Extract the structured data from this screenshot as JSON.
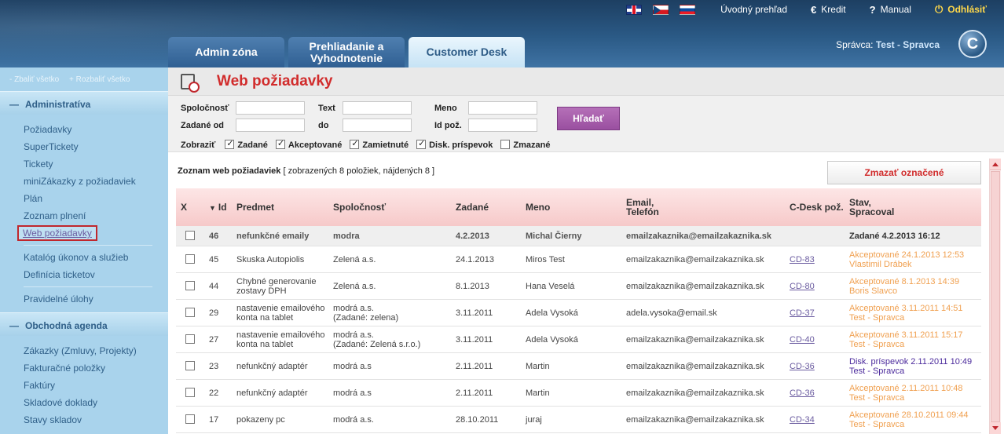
{
  "header": {
    "languages": [
      "uk-flag-icon",
      "cz-flag-icon",
      "sk-flag-icon"
    ],
    "links": {
      "overview": "Úvodný prehľad",
      "credit": "Kredit",
      "manual": "Manual",
      "logout": "Odhlásiť"
    },
    "tabs": [
      {
        "label": "Admin zóna"
      },
      {
        "label": "Prehliadanie a Vyhodnotenie"
      },
      {
        "label": "Customer Desk"
      }
    ],
    "admin_label": "Správca:",
    "admin_name": "Test - Spravca",
    "logo": "C"
  },
  "sidebar": {
    "collapse_all": "- Zbaliť všetko",
    "expand_all": "+ Rozbaliť všetko",
    "sections": [
      {
        "title": "Administratíva",
        "items": [
          "Požiadavky",
          "SuperTickety",
          "Tickety",
          "miniZákazky z požiadaviek",
          "Plán",
          "Zoznam plnení",
          "Web požiadavky",
          "Katalóg úkonov a služieb",
          "Definícia ticketov",
          "Pravidelné úlohy"
        ]
      },
      {
        "title": "Obchodná agenda",
        "items": [
          "Zákazky (Zmluvy, Projekty)",
          "Fakturačné položky",
          "Faktúry",
          "Skladové doklady",
          "Stavy skladov"
        ]
      }
    ]
  },
  "main": {
    "title": "Web požiadavky",
    "filter": {
      "company": "Spoločnosť",
      "text": "Text",
      "name": "Meno",
      "entered_from": "Zadané od",
      "to": "do",
      "req_id": "Id pož.",
      "search_button": "Hľadať",
      "show_label": "Zobraziť",
      "options": [
        "Zadané",
        "Akceptované",
        "Zamietnuté",
        "Disk. príspevok",
        "Zmazané"
      ]
    },
    "list_title": "Zoznam web požiadaviek",
    "list_count": "[ zobrazených 8 položiek, nájdených 8 ]",
    "delete_button": "Zmazať označené",
    "columns": {
      "x": "X",
      "id": "Id",
      "subject": "Predmet",
      "company": "Spoločnosť",
      "entered": "Zadané",
      "name": "Meno",
      "email1": "Email,",
      "email2": "Telefón",
      "cdesk": "C-Desk pož.",
      "status1": "Stav,",
      "status2": "Spracoval"
    },
    "rows": [
      {
        "id": "46",
        "subject": "nefunkčné emaily",
        "company": "modra",
        "company2": "",
        "entered": "4.2.2013",
        "name": "Michal Čierny",
        "email": "emailzakaznika@emailzakaznika.sk",
        "cdesk": "",
        "status": "Zadané 4.2.2013 16:12",
        "by": ""
      },
      {
        "id": "45",
        "subject": "Skuska Autopiolis",
        "company": "Zelená a.s.",
        "company2": "",
        "entered": "24.1.2013",
        "name": "Miros Test",
        "email": "emailzakaznika@emailzakaznika.sk",
        "cdesk": "CD-83",
        "status": "Akceptované 24.1.2013 12:53",
        "by": "Vlastimil Drábek"
      },
      {
        "id": "44",
        "subject": "Chybné generovanie zostavy DPH",
        "company": "Zelená a.s.",
        "company2": "",
        "entered": "8.1.2013",
        "name": "Hana Veselá",
        "email": "emailzakaznika@emailzakaznika.sk",
        "cdesk": "CD-80",
        "status": "Akceptované 8.1.2013 14:39",
        "by": "Boris Slavco"
      },
      {
        "id": "29",
        "subject": "nastavenie emailového konta na tablet",
        "company": "modrá a.s.",
        "company2": "(Zadané: zelena)",
        "entered": "3.11.2011",
        "name": "Adela Vysoká",
        "email": "adela.vysoka@email.sk",
        "cdesk": "CD-37",
        "status": "Akceptované 3.11.2011 14:51",
        "by": "Test - Spravca"
      },
      {
        "id": "27",
        "subject": "nastavenie emailového konta na tablet",
        "company": "modrá a.s.",
        "company2": "(Zadané: Zelená s.r.o.)",
        "entered": "3.11.2011",
        "name": "Adela Vysoká",
        "email": "emailzakaznika@emailzakaznika.sk",
        "cdesk": "CD-40",
        "status": "Akceptované 3.11.2011 15:17",
        "by": "Test - Spravca"
      },
      {
        "id": "23",
        "subject": "nefunkčný adaptér",
        "company": "modrá a.s",
        "company2": "",
        "entered": "2.11.2011",
        "name": "Martin",
        "email": "emailzakaznika@emailzakaznika.sk",
        "cdesk": "CD-36",
        "status": "Disk. príspevok 2.11.2011 10:49",
        "by": "Test - Spravca"
      },
      {
        "id": "22",
        "subject": "nefunkčný adaptér",
        "company": "modrá a.s",
        "company2": "",
        "entered": "2.11.2011",
        "name": "Martin",
        "email": "emailzakaznika@emailzakaznika.sk",
        "cdesk": "CD-36",
        "status": "Akceptované 2.11.2011 10:48",
        "by": "Test - Spravca"
      },
      {
        "id": "17",
        "subject": "pokazeny pc",
        "company": "modrá a.s.",
        "company2": "",
        "entered": "28.10.2011",
        "name": "juraj",
        "email": "emailzakaznika@emailzakaznika.sk",
        "cdesk": "CD-34",
        "status": "Akceptované 28.10.2011 09:44",
        "by": "Test - Spravca"
      }
    ]
  },
  "colors": {
    "header_blue": "#2b5a86",
    "sidebar_blue": "#a9d3ec",
    "accent_red": "#d12c2c",
    "button_purple": "#9a4fa0",
    "status_accepted": "#f0a050",
    "status_discussion": "#4b2a9c"
  }
}
